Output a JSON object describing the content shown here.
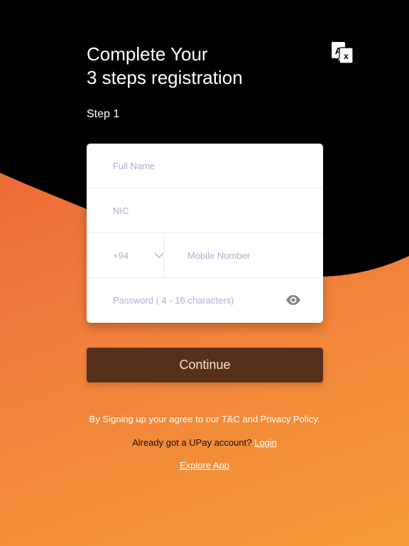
{
  "header": {
    "title_line1": "Complete Your",
    "title_line2": "3 steps registration",
    "step_label": "Step 1",
    "translate_icon": "translate-icon"
  },
  "form": {
    "full_name_placeholder": "Full Name",
    "full_name_value": "",
    "nic_placeholder": "NIC",
    "nic_value": "",
    "country_code": "+94",
    "mobile_placeholder": "Mobile Number",
    "mobile_value": "",
    "password_placeholder": "Password ( 4 - 16 characters)",
    "password_value": "",
    "eye_icon": "eye-icon"
  },
  "actions": {
    "continue_label": "Continue"
  },
  "footer": {
    "terms_text": "By Signing up your agree to our T&C and Privacy Policy.",
    "already_text": "Already got a UPay account?",
    "login_label": "Login",
    "explore_label": "Explore App"
  },
  "colors": {
    "background_top": "#000000",
    "gradient_start": "#e8592c",
    "gradient_end": "#f59c36",
    "button": "#56301a"
  }
}
